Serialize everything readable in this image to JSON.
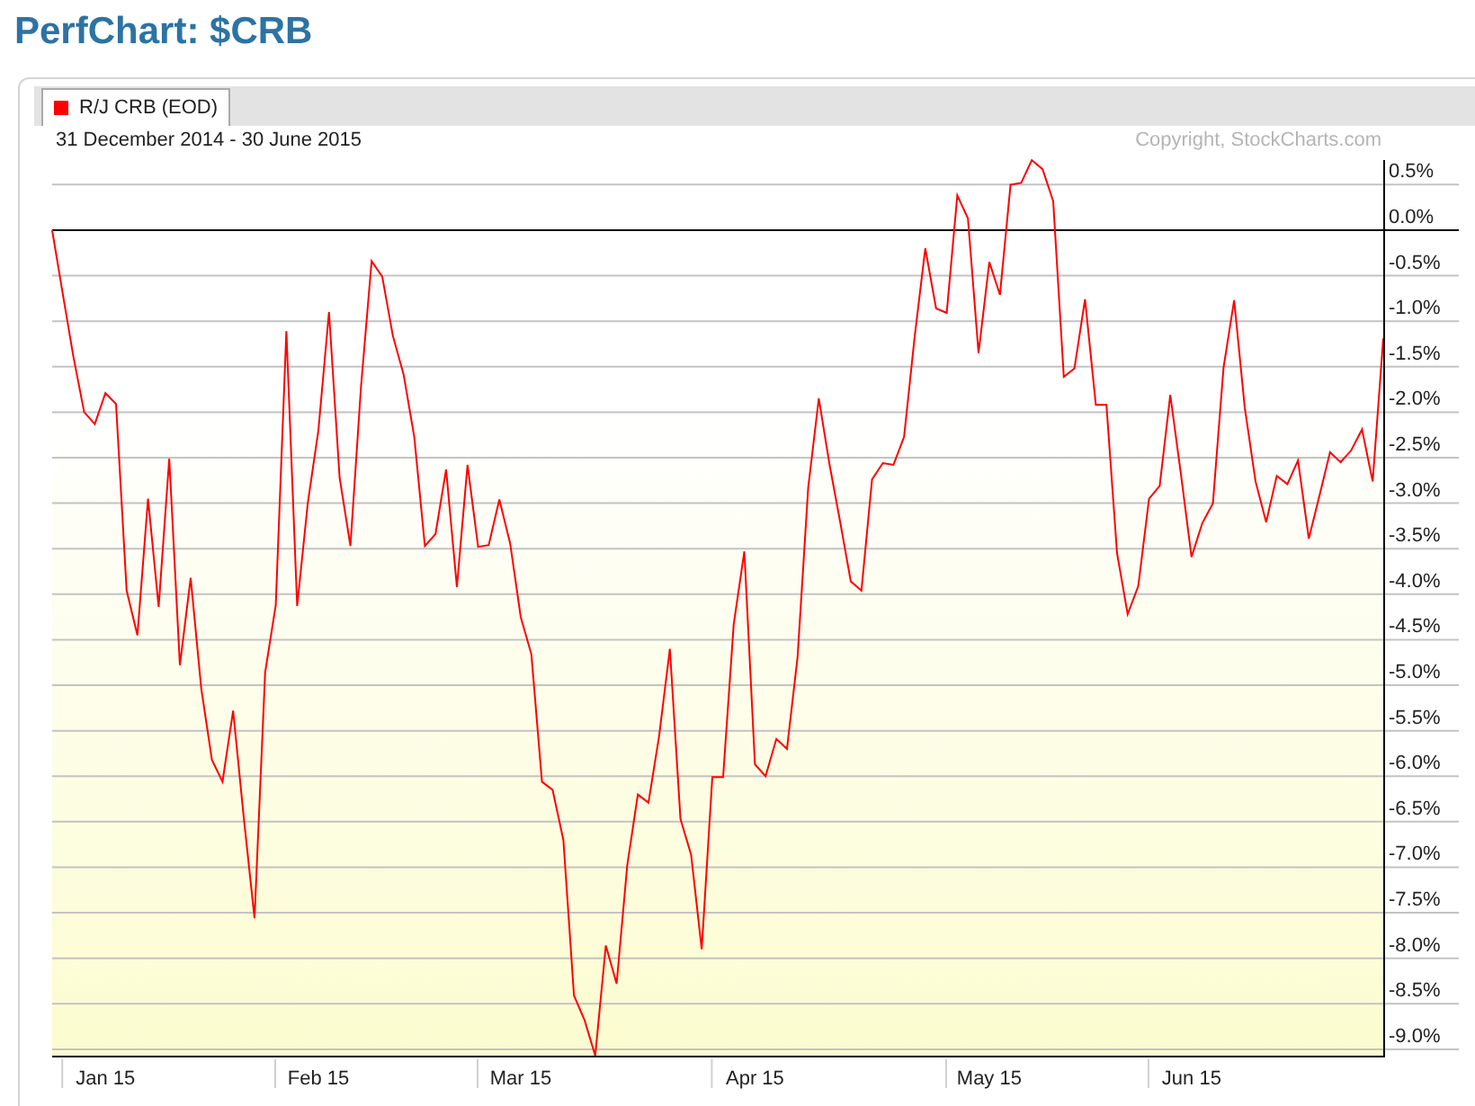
{
  "page_title": "PerfChart: $CRB",
  "chart": {
    "date_range": "31 December 2014 - 30 June 2015",
    "copyright": "Copyright, StockCharts.com",
    "chart_data": {
      "type": "line",
      "grid": true,
      "ylim": [
        -9.07,
        0.77
      ],
      "yticks": [
        {
          "value": 0.5,
          "label": "0.5%"
        },
        {
          "value": 0,
          "label": "0.0%"
        },
        {
          "value": -0.5,
          "label": "-0.5%"
        },
        {
          "value": -1,
          "label": "-1.0%"
        },
        {
          "value": -1.5,
          "label": "-1.5%"
        },
        {
          "value": -2,
          "label": "-2.0%"
        },
        {
          "value": -2.5,
          "label": "-2.5%"
        },
        {
          "value": -3,
          "label": "-3.0%"
        },
        {
          "value": -3.5,
          "label": "-3.5%"
        },
        {
          "value": -4,
          "label": "-4.0%"
        },
        {
          "value": -4.5,
          "label": "-4.5%"
        },
        {
          "value": -5,
          "label": "-5.0%"
        },
        {
          "value": -5.5,
          "label": "-5.5%"
        },
        {
          "value": -6,
          "label": "-6.0%"
        },
        {
          "value": -6.5,
          "label": "-6.5%"
        },
        {
          "value": -7,
          "label": "-7.0%"
        },
        {
          "value": -7.5,
          "label": "-7.5%"
        },
        {
          "value": -8,
          "label": "-8.0%"
        },
        {
          "value": -8.5,
          "label": "-8.5%"
        },
        {
          "value": -9,
          "label": "-9.0%"
        }
      ],
      "categories": [
        null,
        null,
        null,
        null,
        null,
        "Jan 15",
        null,
        null,
        null,
        null,
        null,
        null,
        null,
        null,
        null,
        null,
        null,
        null,
        null,
        null,
        null,
        null,
        null,
        null,
        null,
        "Feb 15",
        null,
        null,
        null,
        null,
        null,
        null,
        null,
        null,
        null,
        null,
        null,
        null,
        null,
        null,
        null,
        null,
        null,
        null,
        "Mar 15",
        null,
        null,
        null,
        null,
        null,
        null,
        null,
        null,
        null,
        null,
        null,
        null,
        null,
        null,
        null,
        null,
        null,
        null,
        null,
        null,
        null,
        "Apr 15",
        null,
        null,
        null,
        null,
        null,
        null,
        null,
        null,
        null,
        null,
        null,
        null,
        null,
        null,
        null,
        null,
        null,
        null,
        null,
        null,
        null,
        "May 15",
        null,
        null,
        null,
        null,
        null,
        null,
        null,
        null,
        null,
        null,
        null,
        null,
        null,
        null,
        null,
        null,
        null,
        null,
        "Jun 15",
        null,
        null,
        null,
        null,
        null,
        null,
        null,
        null,
        null,
        null,
        null,
        null,
        null,
        null,
        null,
        null,
        null,
        null
      ],
      "series": [
        {
          "name": "R/J CRB (EOD)",
          "color": "#ff0000",
          "values": [
            0,
            -0.7,
            -1.39,
            -2,
            -2.13,
            -1.79,
            -1.91,
            -3.96,
            -4.45,
            -2.95,
            -4.14,
            -2.51,
            -4.78,
            -3.82,
            -5.04,
            -5.82,
            -6.06,
            -5.28,
            -6.47,
            -7.56,
            -4.86,
            -4.12,
            -1.11,
            -4.13,
            -3,
            -2.2,
            -0.9,
            -2.72,
            -3.47,
            -1.72,
            -0.34,
            -0.51,
            -1.16,
            -1.59,
            -2.27,
            -3.47,
            -3.34,
            -2.63,
            -3.92,
            -2.58,
            -3.48,
            -3.46,
            -2.96,
            -3.44,
            -4.25,
            -4.66,
            -6.06,
            -6.15,
            -6.7,
            -8.41,
            -8.68,
            -9.07,
            -7.86,
            -8.28,
            -6.98,
            -6.2,
            -6.29,
            -5.56,
            -4.6,
            -6.47,
            -6.86,
            -7.9,
            -6.01,
            -6.01,
            -4.33,
            -3.53,
            -5.87,
            -6,
            -5.59,
            -5.7,
            -4.69,
            -2.83,
            -1.85,
            -2.58,
            -3.21,
            -3.86,
            -3.96,
            -2.74,
            -2.56,
            -2.58,
            -2.27,
            -1.17,
            -0.2,
            -0.86,
            -0.91,
            0.38,
            0.13,
            -1.35,
            -0.35,
            -0.71,
            0.5,
            0.52,
            0.77,
            0.67,
            0.32,
            -1.61,
            -1.52,
            -0.76,
            -1.92,
            -1.92,
            -3.55,
            -4.22,
            -3.91,
            -2.95,
            -2.81,
            -1.81,
            -2.68,
            -3.59,
            -3.22,
            -3,
            -1.51,
            -0.77,
            -1.95,
            -2.76,
            -3.21,
            -2.7,
            -2.79,
            -2.53,
            -3.39,
            -2.92,
            -2.44,
            -2.55,
            -2.42,
            -2.19,
            -2.76,
            -1.19
          ]
        }
      ]
    }
  }
}
